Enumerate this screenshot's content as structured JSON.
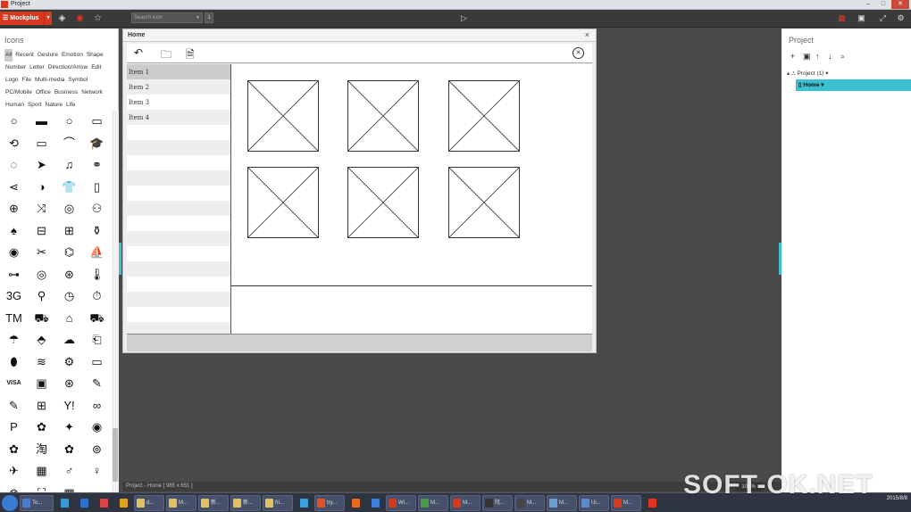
{
  "window": {
    "title": "Project",
    "controls": [
      "–",
      "□",
      "✕"
    ]
  },
  "toolbar": {
    "brand_label": "Mockplus",
    "search_placeholder": "Search icon",
    "search_count": "1"
  },
  "icons_panel": {
    "title": "Icons",
    "categories": [
      "All",
      "Recent",
      "Gesture",
      "Emotion",
      "Shape",
      "Number",
      "Letter",
      "Direction/Arrow",
      "Edit",
      "Logo",
      "File",
      "Multi-media",
      "Symbol",
      "PC/Mobile",
      "Office",
      "Business",
      "Network",
      "Human",
      "Sport",
      "Nature",
      "Life"
    ],
    "selected_category": "All",
    "grid": [
      "○",
      "▬",
      "○",
      "▭",
      "⟲",
      "▭",
      "⌒",
      "🎓",
      "◌",
      "➤",
      "♫",
      "⚭",
      "⋖",
      "◑",
      "👕",
      "▯",
      "⊕",
      "⤨",
      "◎",
      "⚇",
      "♠",
      "⊟",
      "⊞",
      "⚱",
      "◉",
      "✂",
      "⌬",
      "⛵",
      "⊶",
      "◎",
      "⊛",
      "🌡",
      "3G",
      "⚲",
      "◷",
      "⏱",
      "TM",
      "⛟",
      "⌂",
      "⛟",
      "☂",
      "⬘",
      "☁",
      "⎗",
      "⬮",
      "≋",
      "⚙",
      "▭",
      "VISA",
      "▣",
      "⊛",
      "✎",
      "✎",
      "⊞",
      "Y!",
      "∞",
      "P",
      "✿",
      "✦",
      "◉",
      "✿",
      "淘",
      "✿",
      "⊚",
      "✈",
      "▦",
      "♂",
      "♀",
      "⊗",
      "⛶",
      "▦",
      ""
    ],
    "grid_names": [
      "circle-icon",
      "bar-icon",
      "circle-icon",
      "frame-icon",
      "refresh-icon",
      "ruler-icon",
      "arc-icon",
      "graduation-cap-icon",
      "dotted-circle-icon",
      "send-icon",
      "equalizer-icon",
      "link-icon",
      "share-icon",
      "yin-yang-icon",
      "tshirt-icon",
      "clipboard-icon",
      "plus-circle-icon",
      "shuffle-icon",
      "target-icon",
      "group-icon",
      "spade-icon",
      "minus-box-icon",
      "plus-box-icon",
      "stamp-icon",
      "bomb-icon",
      "scissors-icon",
      "network-icon",
      "boat-icon",
      "voicemail-icon",
      "radar-icon",
      "globe-icon",
      "thermometer-icon",
      "3g-icon",
      "tag-icon",
      "clock-icon",
      "stopwatch-icon",
      "trademark-icon",
      "truck-icon",
      "trash-icon",
      "delivery-truck-icon",
      "umbrella-icon",
      "diamond-icon",
      "cloud-icon",
      "phone-icon",
      "battery-icon",
      "layers-icon",
      "gear-icon",
      "camera-icon",
      "visa-icon",
      "wallet-icon",
      "basketball-icon",
      "edit-icon",
      "pen-icon",
      "windows-icon",
      "yahoo-icon",
      "infinity-icon",
      "pinterest-icon",
      "gear-flower-icon",
      "sparkle-icon",
      "weibo-icon",
      "flower-icon",
      "taobao-icon",
      "butterfly-icon",
      "badge-icon",
      "bird-icon",
      "qr-box-icon",
      "male-icon",
      "female-icon",
      "aperture-icon",
      "expand-icon",
      "qr-code-icon",
      "blank-icon"
    ]
  },
  "mockup": {
    "title": "Home",
    "list_items": [
      "Item 1",
      "Item 2",
      "Item 3",
      "Item 4"
    ],
    "close_glyph": "×"
  },
  "project_panel": {
    "title": "Project",
    "root_label": "Project (1)",
    "child_label": "Home"
  },
  "status": {
    "text": "Project - Home [ 985 x 651 ]",
    "zoom": "100%"
  },
  "taskbar": {
    "items": [
      "To...",
      "",
      "",
      "",
      "",
      "d...",
      "M...",
      "新...",
      "新...",
      "fri...",
      "",
      "try...",
      "",
      "",
      "Wi...",
      "M...",
      "M...",
      "阮...",
      "M...",
      "M...",
      "Ui...",
      "M...",
      ""
    ],
    "clock_time": "",
    "clock_date": "2015/8/8"
  },
  "watermark": "SOFT-OK.NET",
  "colors": {
    "brand": "#d8381e",
    "accent": "#3ac0d0"
  }
}
